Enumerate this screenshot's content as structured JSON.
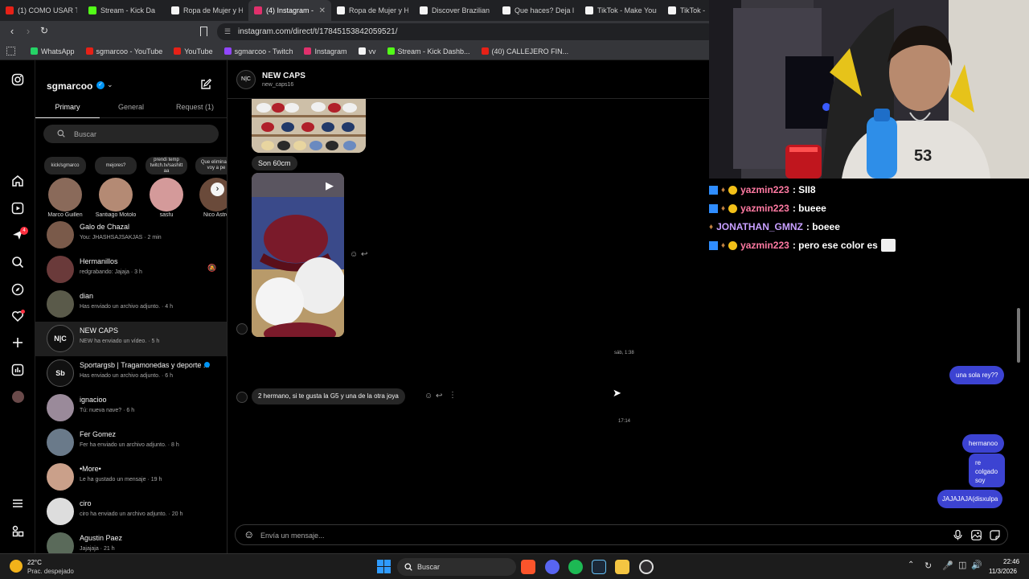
{
  "tabs": [
    {
      "label": "(1) COMO USAR TU",
      "color": "#e62117"
    },
    {
      "label": "Stream - Kick Da",
      "color": "#53fc18"
    },
    {
      "label": "Ropa de Mujer y Ho",
      "color": "#f5f5f5"
    },
    {
      "label": "(4) Instagram -",
      "color": "#e1306c",
      "active": true
    },
    {
      "label": "Ropa de Mujer y Ho",
      "color": "#f5f5f5"
    },
    {
      "label": "Discover Brazilian D",
      "color": "#f5f5f5"
    },
    {
      "label": "Que haces? Deja la",
      "color": "#f5f5f5"
    },
    {
      "label": "TikTok - Make Your",
      "color": "#f5f5f5"
    },
    {
      "label": "TikTok -",
      "color": "#f5f5f5"
    }
  ],
  "url": "instagram.com/direct/t/17845153842059521/",
  "bookmarks": [
    {
      "label": "WhatsApp",
      "color": "#25d366"
    },
    {
      "label": "sgmarcoo - YouTube",
      "color": "#e62117"
    },
    {
      "label": "YouTube",
      "color": "#e62117"
    },
    {
      "label": "sgmarcoo - Twitch",
      "color": "#9146ff"
    },
    {
      "label": "Instagram",
      "color": "#e1306c"
    },
    {
      "label": "vv",
      "color": "#f5f5f5"
    },
    {
      "label": "Stream - Kick Dashb...",
      "color": "#53fc18"
    },
    {
      "label": "(40) CALLEJERO FIN...",
      "color": "#e62117"
    }
  ],
  "inbox": {
    "username": "sgmarcoo",
    "tabs": [
      "Primary",
      "General",
      "Request (1)"
    ],
    "search_placeholder": "Buscar",
    "rail_badge": "4",
    "stories": [
      {
        "note": "kick/sgmarco",
        "name": "Marco Guillen",
        "color": "#8a6a5a"
      },
      {
        "note": "mejores?",
        "name": "Santiago Motolo",
        "color": "#b48a74"
      },
      {
        "note": "prendi temp twitch.tv/sashitt aa",
        "name": "sasfu",
        "color": "#d49a9a"
      },
      {
        "note": "Que elimina le voy a pe",
        "name": "Nico Astro",
        "color": "#6a4a3a"
      }
    ],
    "chats": [
      {
        "name": "Galo de Chazal",
        "preview": "You: JHASHSAJSAKJAS · 2 min",
        "color": "#7a5a4a"
      },
      {
        "name": "Hermanillos",
        "preview": "redgrabando: Jajaja · 3 h",
        "color": "#6a3a3a"
      },
      {
        "name": "dian",
        "preview": "Has enviado un archivo adjunto. · 4 h",
        "color": "#5a5a4a"
      },
      {
        "name": "NEW CAPS",
        "preview": "NEW ha enviado un vídeo. · 5 h",
        "color": "#111111",
        "logo": "N|C"
      },
      {
        "name": "Sportargsb | Tragamonedas y deporte ...",
        "preview": "Has enviado un archivo adjunto. · 6 h",
        "color": "#111111",
        "logo": "Sb"
      },
      {
        "name": "ignacioo",
        "preview": "Tú: nueva nave? · 6 h",
        "color": "#9a8a9a"
      },
      {
        "name": "Fer Gomez",
        "preview": "Fer ha enviado un archivo adjunto. · 8 h",
        "color": "#6a7a8a"
      },
      {
        "name": "•More•",
        "preview": "Le ha gustado un mensaje · 19 h",
        "color": "#caa08a"
      },
      {
        "name": "ciro",
        "preview": "ciro ha enviado un archivo adjunto. · 20 h",
        "color": "#dddddd"
      },
      {
        "name": "Agustin Paez",
        "preview": "Jajajaja · 21 h",
        "color": "#5a6a5a"
      }
    ]
  },
  "conversation": {
    "title": "NEW CAPS",
    "handle": "new_caps16",
    "logo": "N|C",
    "msg_size": "Son 60cm",
    "time1": "sáb, 1:38",
    "msg_in": "2 hermano, si te gusta la G5 y una de la otra joya",
    "time2": "17:14",
    "out": [
      "una sola rey??",
      "hermanoo",
      "re colgado soy",
      "JAJAJAJA(disxulpa"
    ],
    "input_placeholder": "Envía un mensaje..."
  },
  "stream_chat": [
    {
      "user": "yazmin223",
      "text": ": SII8",
      "color": "#ff7aa2"
    },
    {
      "user": "yazmin223",
      "text": ": bueee",
      "color": "#ff7aa2"
    },
    {
      "user": "JONATHAN_GMNZ",
      "text": ": boeee",
      "color": "#c8a0ff"
    },
    {
      "user": "yazmin223",
      "text": ": pero ese color es",
      "color": "#ff7aa2"
    }
  ],
  "webcam_shirt": "53",
  "taskbar": {
    "temp": "22°C",
    "weather": "Prac. despejado",
    "search": "Buscar",
    "time": "22:46",
    "date": "11/3/2026"
  }
}
